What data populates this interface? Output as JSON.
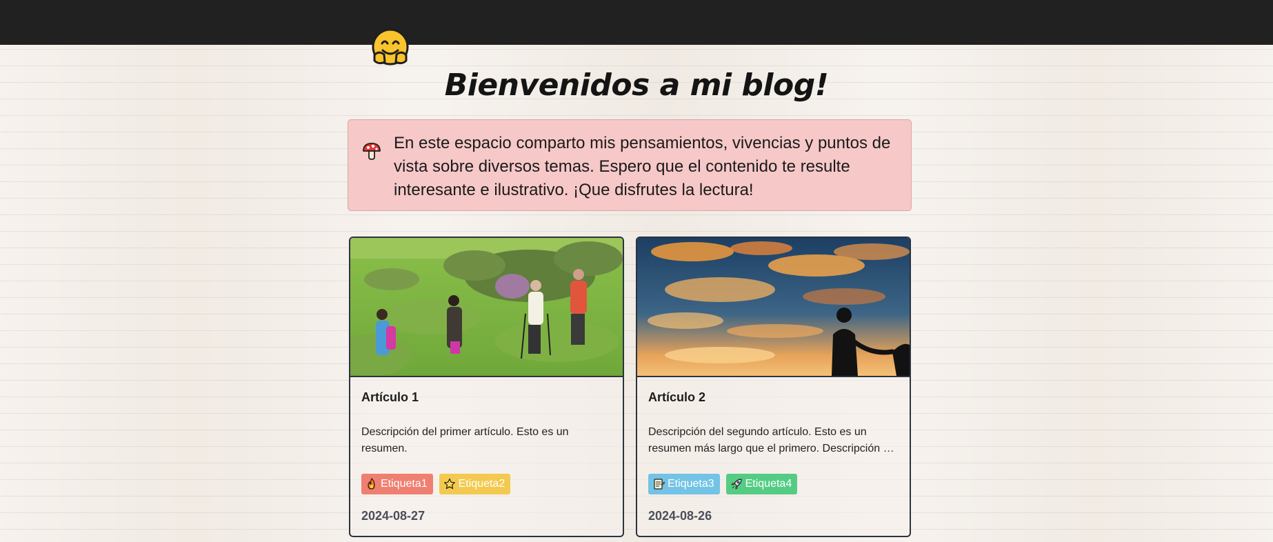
{
  "header": {
    "title": "Bienvenidos a mi blog!",
    "logo_icon": "hugging-face-emoji-icon"
  },
  "intro": {
    "icon": "mushroom-icon",
    "text": "En este espacio comparto mis pensamientos, vivencias y puntos de vista sobre diversos temas. Espero que el contenido te resulte interesante e ilustrativo. ¡Que disfrutes la lectura!",
    "background_color": "#f6c8c8"
  },
  "articles": [
    {
      "title": "Artículo 1",
      "description": "Descripción del primer artículo. Esto es un resumen.",
      "image": "hikers-on-green-hill-photo",
      "tags": [
        {
          "label": "Etiqueta1",
          "icon": "fire-icon",
          "color": "#ef7f70"
        },
        {
          "label": "Etiqueta2",
          "icon": "star-icon",
          "color": "#f3c94f"
        }
      ],
      "date": "2024-08-27"
    },
    {
      "title": "Artículo 2",
      "description": "Descripción del segundo artículo. Esto es un resumen más largo que el primero. Descripción del segundo artículo.",
      "image": "sunset-clouds-silhouette-photo",
      "tags": [
        {
          "label": "Etiqueta3",
          "icon": "memo-icon",
          "color": "#73c3e6"
        },
        {
          "label": "Etiqueta4",
          "icon": "rocket-icon",
          "color": "#55cc84"
        }
      ],
      "date": "2024-08-26"
    }
  ]
}
